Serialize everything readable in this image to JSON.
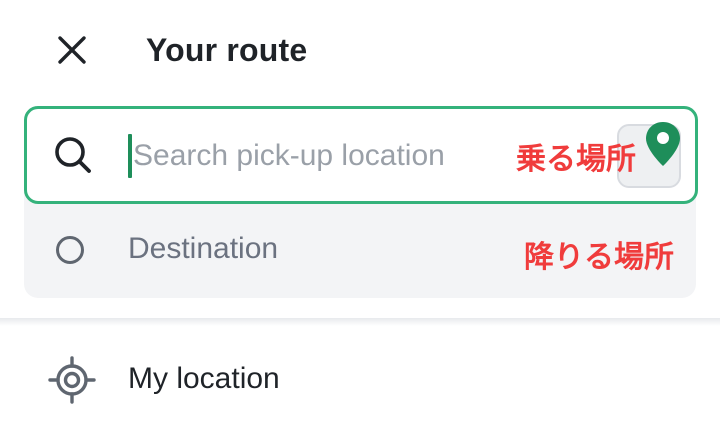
{
  "header": {
    "title": "Your route",
    "close_icon": "close-icon"
  },
  "pickup": {
    "placeholder": "Search pick-up location",
    "value": "",
    "annotation": "乗る場所",
    "search_icon": "search-icon",
    "map_button_icon": "map-pin-icon"
  },
  "destination": {
    "label": "Destination",
    "annotation": "降りる場所",
    "icon": "circle-outline-icon"
  },
  "suggestions": [
    {
      "label": "My location",
      "icon": "crosshair-target-icon"
    }
  ],
  "colors": {
    "accent": "#34b27b",
    "pin": "#1e8e5a",
    "annotation": "#f03c3c",
    "panel": "#f3f4f6",
    "text": "#1f2328",
    "muted": "#6b7280"
  }
}
